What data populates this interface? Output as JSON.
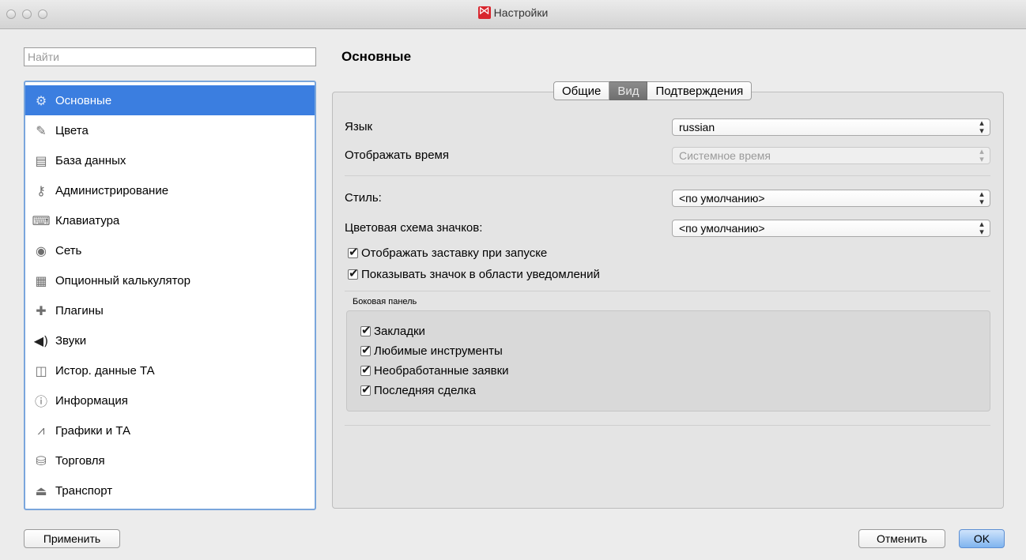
{
  "window": {
    "title": "Настройки"
  },
  "search": {
    "placeholder": "Найти"
  },
  "sidebar": {
    "items": [
      {
        "label": "Основные",
        "icon": "gear-icon",
        "selected": true
      },
      {
        "label": "Цвета",
        "icon": "brush-icon"
      },
      {
        "label": "База данных",
        "icon": "database-icon"
      },
      {
        "label": "Администрирование",
        "icon": "key-icon"
      },
      {
        "label": "Клавиатура",
        "icon": "keyboard-icon"
      },
      {
        "label": "Сеть",
        "icon": "network-icon"
      },
      {
        "label": "Опционный калькулятор",
        "icon": "calculator-icon"
      },
      {
        "label": "Плагины",
        "icon": "puzzle-icon"
      },
      {
        "label": "Звуки",
        "icon": "speaker-icon"
      },
      {
        "label": "Истор. данные ТА",
        "icon": "history-chart-icon"
      },
      {
        "label": "Информация",
        "icon": "info-icon"
      },
      {
        "label": "Графики и ТА",
        "icon": "chart-icon"
      },
      {
        "label": "Торговля",
        "icon": "coins-icon"
      },
      {
        "label": "Транспорт",
        "icon": "transport-icon"
      }
    ]
  },
  "main": {
    "heading": "Основные",
    "tabs": [
      {
        "label": "Общие",
        "active": false
      },
      {
        "label": "Вид",
        "active": true
      },
      {
        "label": "Подтверждения",
        "active": false
      }
    ],
    "language": {
      "label": "Язык",
      "value": "russian"
    },
    "time": {
      "label": "Отображать время",
      "value": "Системное время",
      "disabled": true
    },
    "style": {
      "label": "Стиль:",
      "value": "<по умолчанию>"
    },
    "icon_scheme": {
      "label": "Цветовая схема значков:",
      "value": "<по умолчанию>"
    },
    "checkboxes": [
      {
        "label": "Отображать заставку при запуске",
        "checked": true
      },
      {
        "label": "Показывать значок в области уведомлений",
        "checked": true
      }
    ],
    "sidebar_group": {
      "title": "Боковая панель",
      "items": [
        {
          "label": "Закладки",
          "checked": true
        },
        {
          "label": "Любимые инструменты",
          "checked": true
        },
        {
          "label": "Необработанные заявки",
          "checked": true
        },
        {
          "label": "Последняя сделка",
          "checked": true
        }
      ]
    }
  },
  "footer": {
    "apply": "Применить",
    "cancel": "Отменить",
    "ok": "OK"
  },
  "colors": {
    "accent": "#3b7ee0",
    "brand": "#d8262e"
  }
}
